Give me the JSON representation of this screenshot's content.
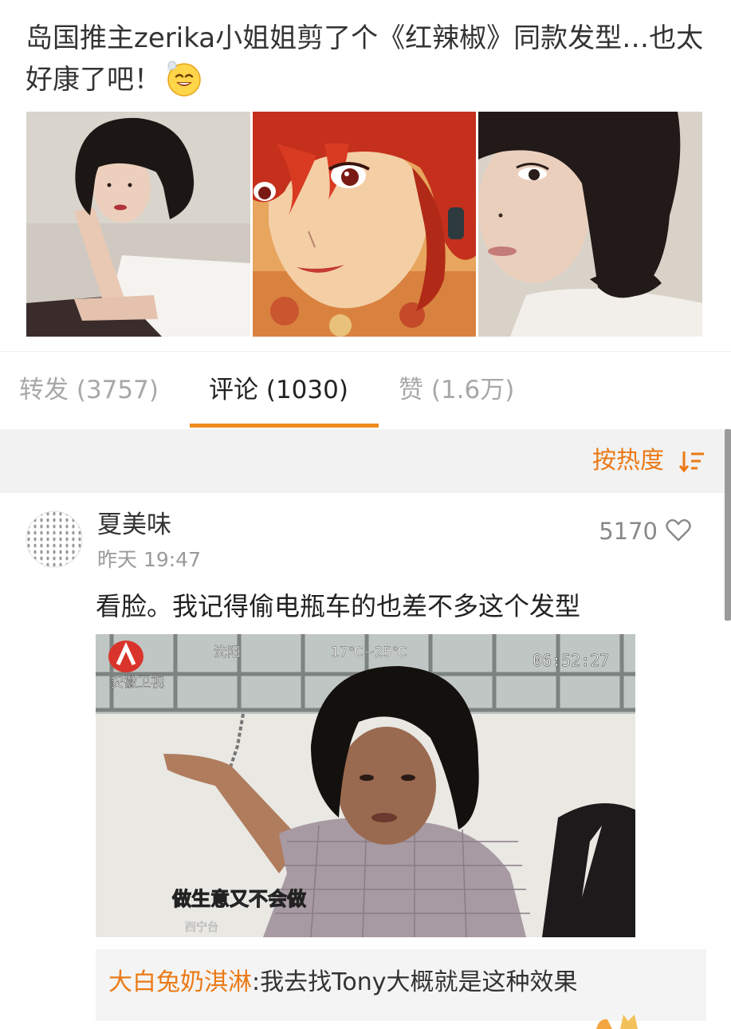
{
  "post": {
    "text": "岛国推主zerika小姐姐剪了个《红辣椒》同款发型…也太好康了吧！",
    "emoji": "drooling-face-emoji",
    "photos": [
      "photo-bob-haircut-1",
      "photo-anime-paprika",
      "photo-bob-haircut-2"
    ]
  },
  "tabs": {
    "forward": "转发 (3757)",
    "comments": "评论 (1030)",
    "likes": "赞 (1.6万)"
  },
  "sort": {
    "label": "按热度",
    "icon": "sort-descending-icon"
  },
  "comment": {
    "username": "夏美味",
    "time": "昨天 19:47",
    "likes": "5170",
    "text": "看脸。我记得偷电瓶车的也差不多这个发型",
    "image": {
      "channel": "安徽卫视",
      "city": "沈阳",
      "weather": "17℃~25℃",
      "clock": "06:52:27",
      "subtitle": "做生意又不会做",
      "corner_text": "西宁台"
    },
    "reply": {
      "user": "大白兔奶淇淋",
      "text": ":我去找Tony大概就是这种效果"
    }
  },
  "colors": {
    "accent": "#eb7a16",
    "tab_indicator": "#f08b1e",
    "sort_bar_bg": "#f2f2f2",
    "reply_bg": "#f4f4f4"
  }
}
